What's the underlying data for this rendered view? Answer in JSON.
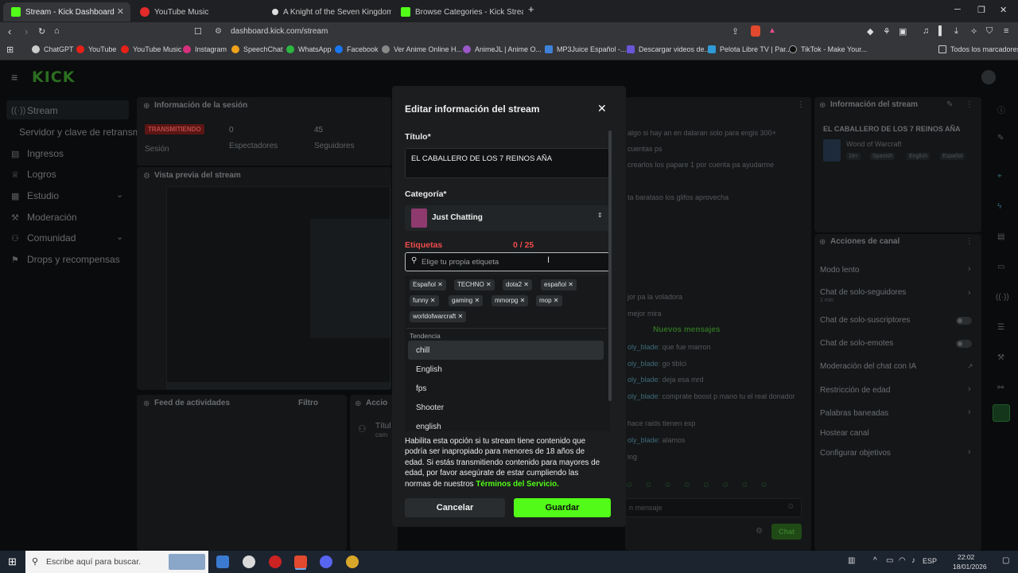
{
  "browser": {
    "tabs": [
      {
        "label": "Stream - Kick Dashboard",
        "icon": "kick-icon",
        "active": true
      },
      {
        "label": "YouTube Music",
        "icon": "youtube-music-icon"
      },
      {
        "label": "A Knight of the Seven Kingdoms • HBO",
        "icon": "hbo-icon"
      },
      {
        "label": "Browse Categories - Kick Streaming",
        "icon": "kick-icon"
      }
    ],
    "url": "dashboard.kick.com/stream",
    "bookmarks": [
      "ChatGPT",
      "YouTube",
      "YouTube Music",
      "Instagram",
      "SpeechChat",
      "WhatsApp",
      "Facebook",
      "Ver Anime Online H...",
      "AnimeJL | Anime O...",
      "MP3Juice Español -...",
      "Descargar videos de...",
      "Pelota Libre TV | Par...",
      "TikTok - Make Your..."
    ],
    "bookmarks_folder": "Todos los marcadores"
  },
  "sidebar": {
    "logo": "KICK",
    "items": [
      {
        "label": "Stream",
        "icon": "broadcast-icon"
      },
      {
        "label": "Servidor y clave de retransmi"
      },
      {
        "label": "Ingresos",
        "icon": "money-icon"
      },
      {
        "label": "Logros",
        "icon": "trophy-icon"
      },
      {
        "label": "Estudio",
        "icon": "studio-icon"
      },
      {
        "label": "Moderación",
        "icon": "wrench-icon"
      },
      {
        "label": "Comunidad",
        "icon": "users-icon"
      },
      {
        "label": "Drops y recompensas",
        "icon": "gift-icon"
      }
    ]
  },
  "session": {
    "title": "Información de la sesión",
    "status": "TRANSMITIENDO",
    "status_label": "Sesión",
    "viewers": "0",
    "viewers_label": "Espectadores",
    "followers": "45",
    "followers_label": "Seguidores",
    "preview_title": "Vista previa del stream",
    "feed_title": "Feed de actividades",
    "feed_filter": "Filtro",
    "actions_title": "Accio",
    "actions_item": "Títul",
    "actions_sub": "cam"
  },
  "chat": {
    "lines": [
      "algo si hay an en dalaran solo para engis 300+",
      "cuentas ps",
      "crearlos los papare 1 por cuenta pa ayudarme",
      "ta barataso los glifos aprovecha",
      "jor pa la voladora",
      "mejor mira"
    ],
    "new_messages": "Nuevos mensajes",
    "messages": [
      {
        "user": "oly_blade",
        "text": ": que fue marron"
      },
      {
        "user": "oly_blade",
        "text": ": go tiblci"
      },
      {
        "user": "oly_blade",
        "text": ": deja esa mrd"
      },
      {
        "user": "oly_blade",
        "text": ": comprate boost p mano tu el real donador"
      },
      {
        "user": "",
        "text": "hace raids tienen exp"
      },
      {
        "user": "oly_blade",
        "text": ": alamos"
      },
      {
        "user": "",
        "text": "ing"
      }
    ],
    "input_placeholder": "n mensaje",
    "send": "Chat"
  },
  "stream_info": {
    "title": "Información del stream",
    "stream_title": "EL CABALLERO DE LOS 7 REINOS AÑA",
    "game": "Wond of Warcraft",
    "tags": [
      "18+",
      "Spanish",
      "English",
      "Español"
    ]
  },
  "channel_actions": {
    "title": "Acciones de canal",
    "items": [
      {
        "label": "Modo lento",
        "type": "arrow"
      },
      {
        "label": "Chat de solo-seguidores",
        "sub": "1 min",
        "type": "arrow"
      },
      {
        "label": "Chat de solo-suscriptores",
        "type": "toggle"
      },
      {
        "label": "Chat de solo-emotes",
        "type": "toggle"
      },
      {
        "label": "Moderación del chat con IA",
        "type": "link"
      },
      {
        "label": "Restricción de edad",
        "type": "arrow"
      },
      {
        "label": "Palabras baneadas",
        "type": "arrow"
      },
      {
        "label": "Hostear canal",
        "type": "none"
      },
      {
        "label": "Configurar objetivos",
        "type": "arrow"
      }
    ]
  },
  "modal": {
    "title": "Editar información del stream",
    "title_label": "Título*",
    "title_value": "EL CABALLERO DE LOS 7 REINOS AÑA",
    "category_label": "Categoría*",
    "category_value": "Just Chatting",
    "tags_label": "Etiquetas",
    "tags_count": "0 / 25",
    "tags_placeholder": "Elige tu propia etiqueta",
    "tags": [
      "Español",
      "TECHNO",
      "dota2",
      "español",
      "funny",
      "gaming",
      "mmorpg",
      "mop",
      "worldofwarcraft"
    ],
    "trending_label": "Tendencia",
    "trending": [
      "chill",
      "English",
      "fps",
      "Shooter",
      "english"
    ],
    "age_text": "Habilita esta opción si tu stream tiene contenido que podría ser inapropiado para menores de 18 años de edad. Si estás transmitiendo contenido para mayores de edad, por favor asegúrate de estar cumpliendo las normas de nuestros ",
    "tos_link": "Términos del Servicio.",
    "cancel": "Cancelar",
    "save": "Guardar",
    "accent": "#53fc18"
  },
  "taskbar": {
    "search_placeholder": "Escribe aquí para buscar.",
    "lang": "ESP",
    "time": "22:02",
    "date": "18/01/2026"
  }
}
